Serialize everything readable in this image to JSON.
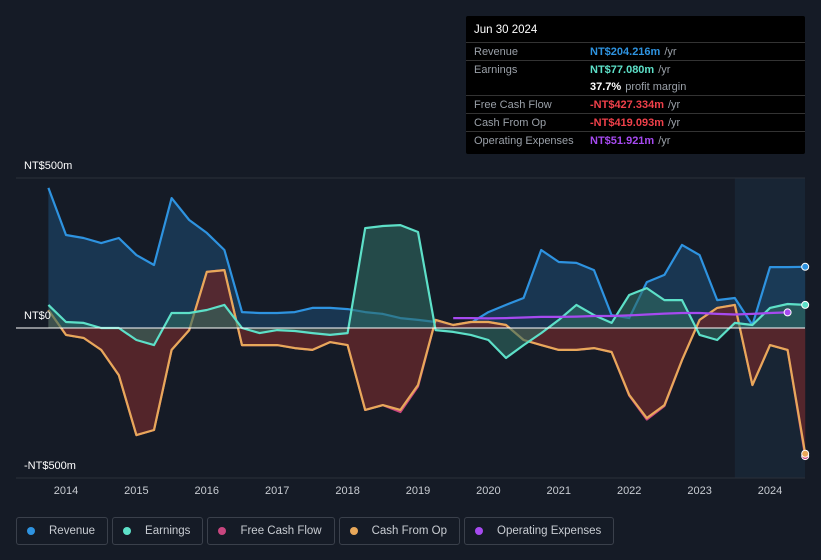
{
  "tooltip": {
    "date": "Jun 30 2024",
    "rows": [
      {
        "label": "Revenue",
        "value": "NT$204.216m",
        "unit": "/yr",
        "color": "#2e93e0"
      },
      {
        "label": "Earnings",
        "value": "NT$77.080m",
        "unit": "/yr",
        "color": "#5de0c8"
      },
      {
        "label": "",
        "value": "37.7%",
        "unit": "profit margin",
        "color": "#ffffff"
      },
      {
        "label": "Free Cash Flow",
        "value": "-NT$427.334m",
        "unit": "/yr",
        "color": "#f0404a"
      },
      {
        "label": "Cash From Op",
        "value": "-NT$419.093m",
        "unit": "/yr",
        "color": "#f0404a"
      },
      {
        "label": "Operating Expenses",
        "value": "NT$51.921m",
        "unit": "/yr",
        "color": "#a64af0"
      }
    ]
  },
  "chart_data": {
    "type": "area",
    "y_tick_labels": [
      "NT$500m",
      "NT$0",
      "-NT$500m"
    ],
    "ylim": [
      -500,
      500
    ],
    "x_tick_labels": [
      "2014",
      "2015",
      "2016",
      "2017",
      "2018",
      "2019",
      "2020",
      "2021",
      "2022",
      "2023",
      "2024"
    ],
    "xlim": [
      2013.75,
      2024.5
    ],
    "x_start": 2013.75,
    "x_step": 0.25,
    "forecast_shade_from": 2023.5,
    "series": [
      {
        "name": "Revenue",
        "color": "#2e93e0",
        "values": [
          467,
          310,
          300,
          283,
          300,
          243,
          210,
          433,
          360,
          317,
          260,
          53,
          50,
          50,
          53,
          67,
          67,
          63,
          53,
          47,
          33,
          27,
          20,
          10,
          17,
          53,
          77,
          100,
          260,
          220,
          217,
          193,
          43,
          33,
          153,
          177,
          277,
          243,
          93,
          100,
          10,
          203,
          203,
          204
        ]
      },
      {
        "name": "Earnings",
        "color": "#5de0c8",
        "values": [
          77,
          20,
          17,
          0,
          0,
          -40,
          -57,
          50,
          50,
          60,
          77,
          0,
          -17,
          -7,
          -10,
          -17,
          -23,
          -17,
          333,
          340,
          343,
          320,
          -7,
          -13,
          -23,
          -40,
          -100,
          -57,
          -17,
          27,
          77,
          43,
          17,
          110,
          133,
          93,
          93,
          -23,
          -40,
          17,
          10,
          67,
          80,
          77
        ]
      },
      {
        "name": "Free Cash Flow",
        "color": "#c8467f",
        "values": [
          60,
          -23,
          -33,
          -73,
          -157,
          -357,
          -340,
          -73,
          -7,
          187,
          193,
          -57,
          -57,
          -57,
          -67,
          -73,
          -47,
          -57,
          -273,
          -257,
          -280,
          -195,
          27,
          10,
          20,
          20,
          10,
          -40,
          -57,
          -73,
          -73,
          -67,
          -80,
          -225,
          -305,
          -260,
          -107,
          27,
          67,
          77,
          -190,
          -57,
          -73,
          -427
        ]
      },
      {
        "name": "Cash From Op",
        "color": "#e8a85a",
        "values": [
          60,
          -23,
          -33,
          -73,
          -157,
          -357,
          -340,
          -73,
          -7,
          187,
          193,
          -57,
          -57,
          -57,
          -67,
          -73,
          -47,
          -57,
          -273,
          -257,
          -273,
          -190,
          27,
          10,
          20,
          20,
          10,
          -40,
          -57,
          -73,
          -73,
          -67,
          -80,
          -223,
          -300,
          -257,
          -107,
          27,
          67,
          77,
          -190,
          -57,
          -73,
          -419
        ]
      },
      {
        "name": "Operating Expenses",
        "color": "#a64af0",
        "start": 2019.5,
        "values": [
          33,
          33,
          32,
          33,
          35,
          37,
          37,
          38,
          40,
          40,
          42,
          45,
          48,
          50,
          50,
          47,
          45,
          47,
          50,
          52
        ]
      }
    ]
  },
  "legend": [
    "Revenue",
    "Earnings",
    "Free Cash Flow",
    "Cash From Op",
    "Operating Expenses"
  ]
}
